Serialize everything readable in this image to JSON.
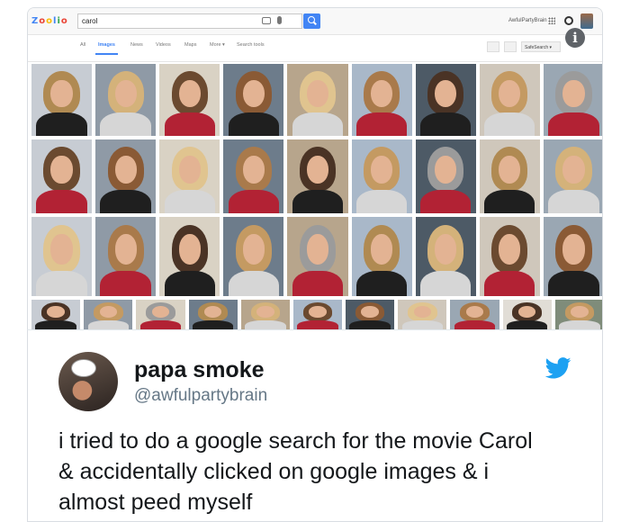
{
  "google": {
    "logo": "Zoolio",
    "search_value": "carol",
    "account_name": "AwfulPartyBrain",
    "tabs": [
      {
        "label": "All",
        "active": false
      },
      {
        "label": "Images",
        "active": true
      },
      {
        "label": "News",
        "active": false
      },
      {
        "label": "Videos",
        "active": false
      },
      {
        "label": "Maps",
        "active": false
      },
      {
        "label": "More ▾",
        "active": false
      },
      {
        "label": "Search tools",
        "active": false
      }
    ],
    "safesearch_label": "SafeSearch ▾",
    "info_icon": "i"
  },
  "image_grid": {
    "rows": [
      {
        "count": 9
      },
      {
        "count": 9
      },
      {
        "count": 9
      },
      {
        "count": 11
      }
    ]
  },
  "tweet": {
    "display_name": "papa smoke",
    "handle": "@awfulpartybrain",
    "text_lines": [
      "i tried to do a google search for the movie Carol",
      "& accidentally clicked on google images & i",
      "almost peed myself"
    ],
    "brand_color": "#1da1f2"
  },
  "icons": {
    "search": "search-icon",
    "camera": "camera-icon",
    "mic": "mic-icon",
    "apps": "apps-grid-icon",
    "notifications": "notifications-icon",
    "info": "info-icon",
    "twitter": "twitter-bird-icon"
  }
}
